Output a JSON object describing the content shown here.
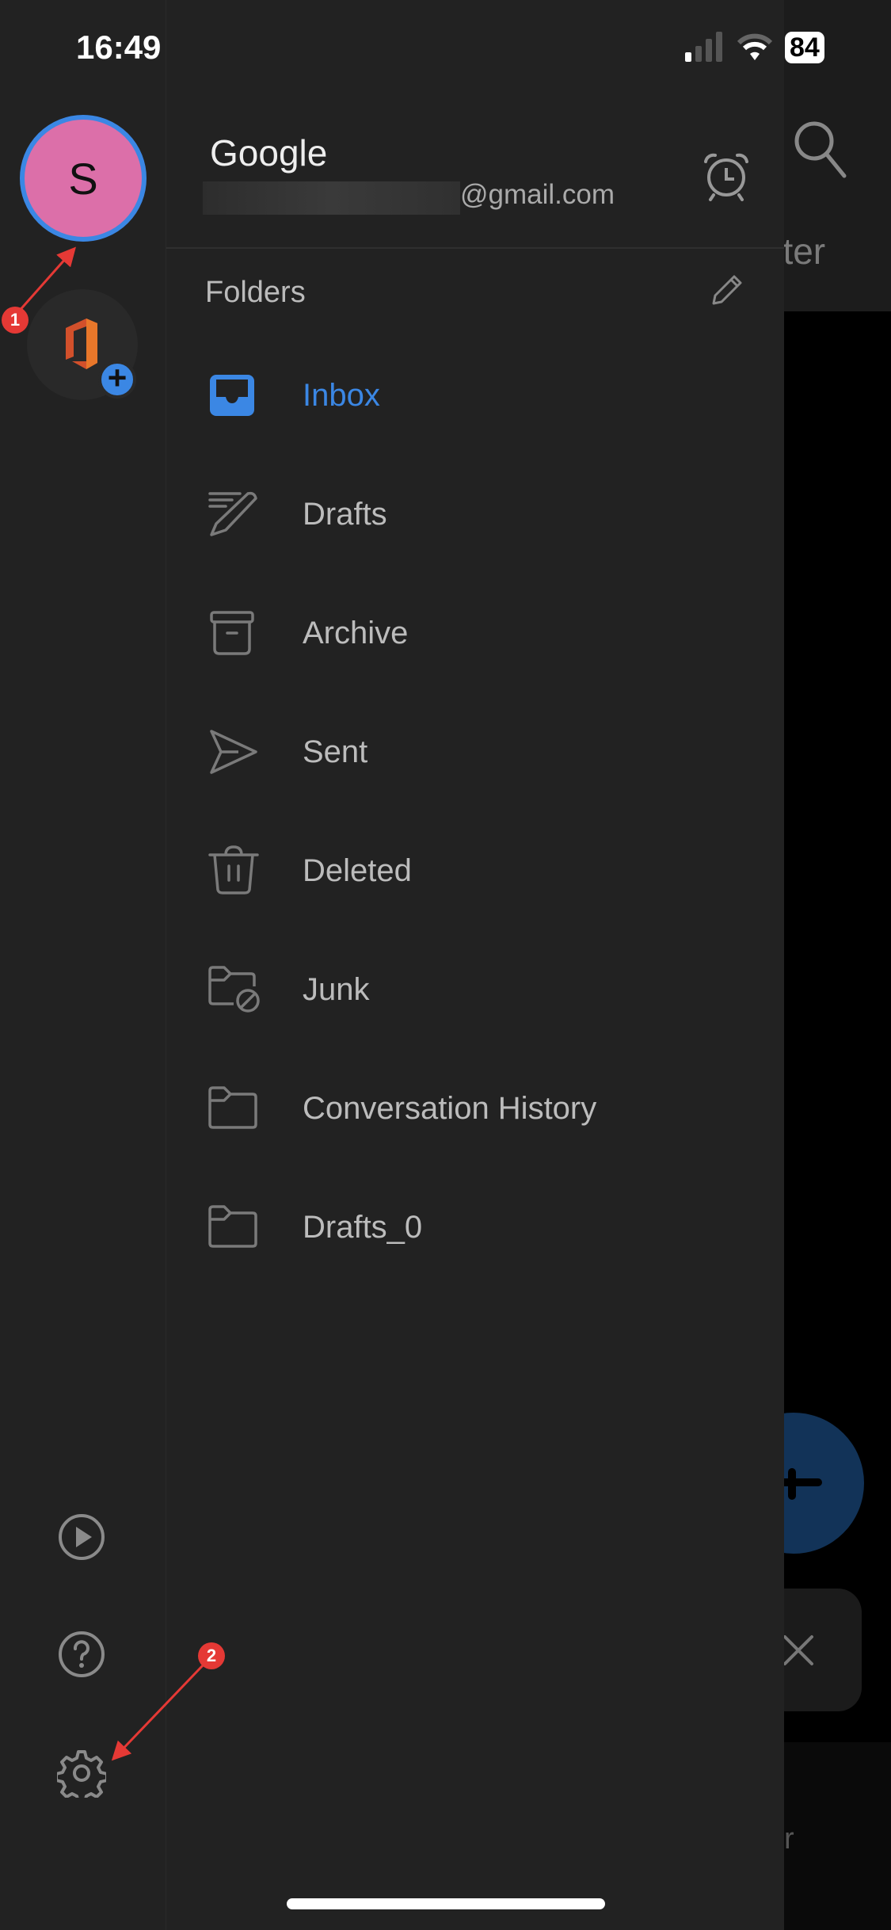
{
  "status_bar": {
    "time": "16:49",
    "battery": "84"
  },
  "background": {
    "filter_fragment": "ilter",
    "bottom_fragment": "r"
  },
  "account": {
    "avatar_initial": "S",
    "name": "Google",
    "email_suffix": "@gmail.com"
  },
  "folders": {
    "heading": "Folders",
    "items": [
      {
        "label": "Inbox",
        "icon": "inbox-icon",
        "active": true
      },
      {
        "label": "Drafts",
        "icon": "drafts-icon"
      },
      {
        "label": "Archive",
        "icon": "archive-icon"
      },
      {
        "label": "Sent",
        "icon": "sent-icon"
      },
      {
        "label": "Deleted",
        "icon": "trash-icon"
      },
      {
        "label": "Junk",
        "icon": "junk-folder-icon"
      },
      {
        "label": "Conversation History",
        "icon": "folder-icon"
      },
      {
        "label": "Drafts_0",
        "icon": "folder-icon"
      }
    ]
  },
  "annotations": [
    {
      "label": "1"
    },
    {
      "label": "2"
    }
  ],
  "colors": {
    "accent": "#3b87e4",
    "avatar": "#dc6fa9",
    "annotation": "#e53935"
  }
}
